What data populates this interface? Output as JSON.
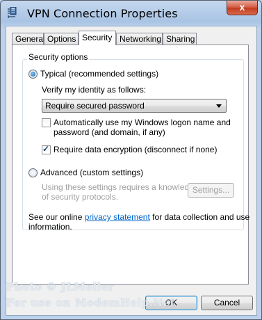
{
  "window": {
    "title": "VPN Connection Properties",
    "close_glyph": "x",
    "app_icon": "network-connection-icon"
  },
  "tabs": [
    {
      "label": "General",
      "active": false
    },
    {
      "label": "Options",
      "active": false
    },
    {
      "label": "Security",
      "active": true
    },
    {
      "label": "Networking",
      "active": false
    },
    {
      "label": "Sharing",
      "active": false
    }
  ],
  "security": {
    "group_label": "Security options",
    "typical": {
      "label": "Typical (recommended settings)",
      "selected": true
    },
    "verify_label": "Verify my identity as follows:",
    "verify_value": "Require secured password",
    "auto_logon": {
      "line1": "Automatically use my Windows logon name and",
      "line2": "password (and domain, if any)",
      "checked": false
    },
    "encryption": {
      "label": "Require data encryption (disconnect if none)",
      "checked": true
    },
    "advanced": {
      "label": "Advanced (custom settings)",
      "selected": false
    },
    "advanced_desc_line1": "Using these settings requires a knowledge",
    "advanced_desc_line2": "of security protocols.",
    "settings_button": "Settings...",
    "privacy_prefix": "See our online ",
    "privacy_link": "privacy statement",
    "privacy_suffix": " for data collection and use",
    "privacy_line2": "information."
  },
  "buttons": {
    "ok": "OK",
    "cancel": "Cancel"
  },
  "watermark": {
    "line1": "Photo © JLMeller",
    "line2": "For use on ModemHelp.Net"
  },
  "colors": {
    "accent": "#3c7fb1",
    "link": "#0066cc",
    "title_bar": "#b9d1ea",
    "close": "#c2391e"
  }
}
